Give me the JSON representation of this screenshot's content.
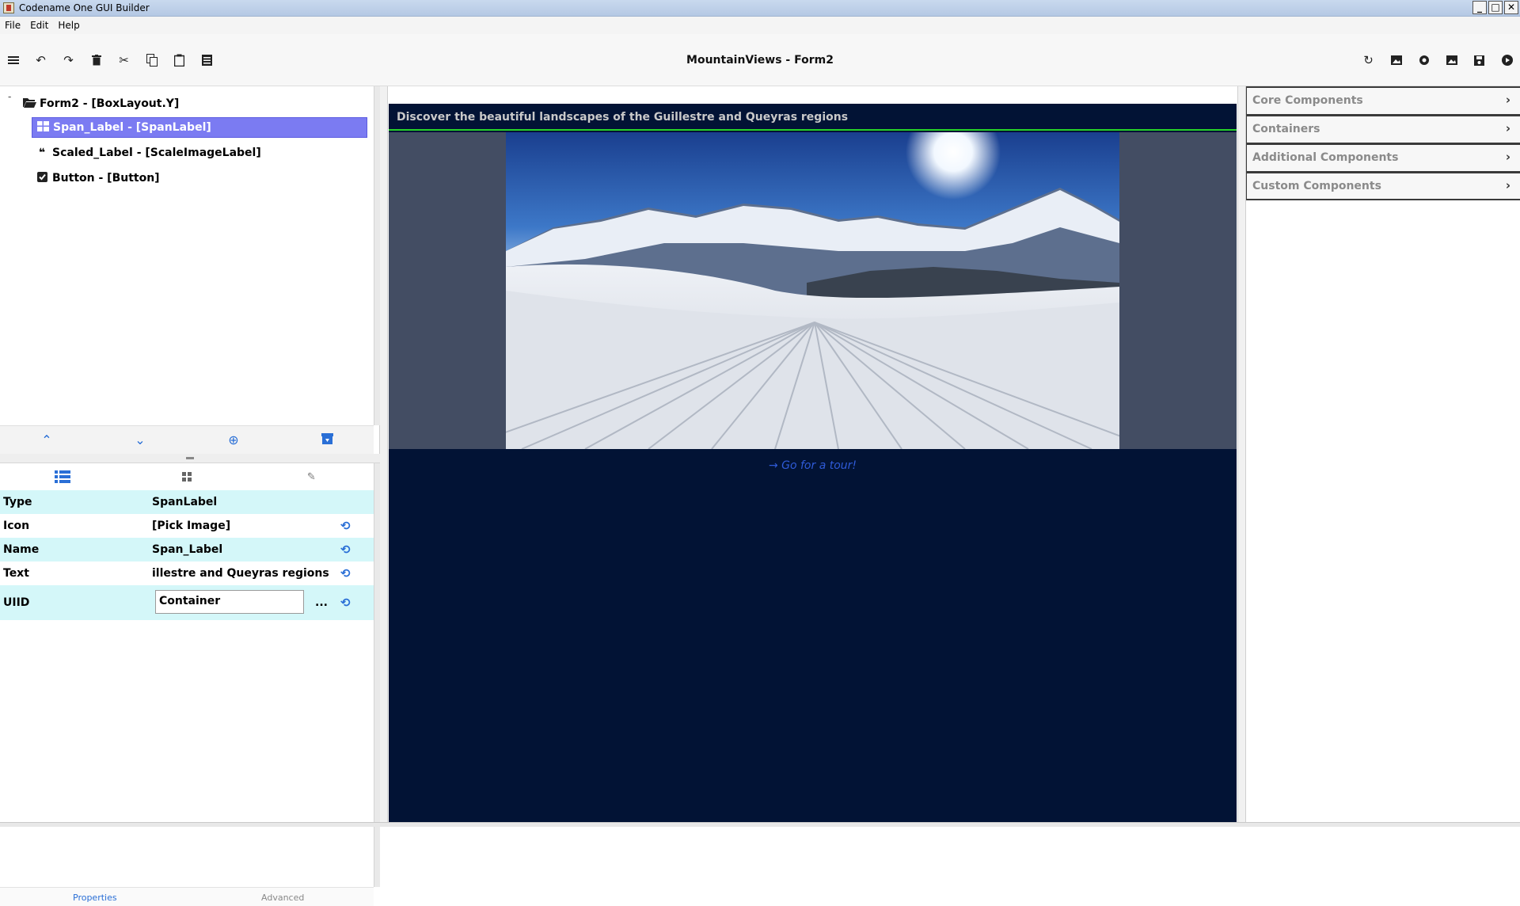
{
  "window": {
    "title": "Codename One GUI Builder"
  },
  "menu": {
    "items": [
      "File",
      "Edit",
      "Help"
    ]
  },
  "toolbar": {
    "document_title": "MountainViews - Form2",
    "left_icons": [
      "hamburger-menu-icon",
      "undo-icon",
      "redo-icon",
      "delete-icon",
      "cut-icon",
      "copy-icon",
      "paste-icon",
      "list-icon"
    ],
    "right_icons": [
      "refresh-icon",
      "image-icon",
      "record-icon",
      "image-icon",
      "save-icon",
      "play-icon"
    ]
  },
  "tree": {
    "root": {
      "label": "Form2 - [BoxLayout.Y]",
      "toggle": "-"
    },
    "children": [
      {
        "label": "Span_Label - [SpanLabel]",
        "icon": "grid-icon",
        "selected": true
      },
      {
        "label": "Scaled_Label - [ScaleImageLabel]",
        "icon": "quote-icon",
        "selected": false
      },
      {
        "label": "Button - [Button]",
        "icon": "checkbox-icon",
        "selected": false
      }
    ]
  },
  "properties": {
    "rows": [
      {
        "name": "Type",
        "value": "SpanLabel"
      },
      {
        "name": "Icon",
        "value": "[Pick Image]"
      },
      {
        "name": "Name",
        "value": "Span_Label"
      },
      {
        "name": "Text",
        "value": "illestre and Queyras regions"
      },
      {
        "name": "UIID",
        "value": "Container",
        "extra": "..."
      }
    ],
    "bottom_tabs": [
      "Properties",
      "Advanced"
    ]
  },
  "canvas": {
    "header_text": "Discover the beautiful landscapes of the Guillestre and Queyras regions",
    "button_text": "Go for a tour!",
    "colors": {
      "form_bg": "#021335",
      "image_band": "#434d63",
      "header_line": "#27d127",
      "button_text": "#2f5bd8"
    }
  },
  "palette": {
    "sections": [
      "Core Components",
      "Containers",
      "Additional Components",
      "Custom Components"
    ]
  },
  "colors": {
    "selection": "#7b7bf2",
    "property_tint": "#d4f7f9",
    "accent_blue": "#2a6fd6"
  }
}
